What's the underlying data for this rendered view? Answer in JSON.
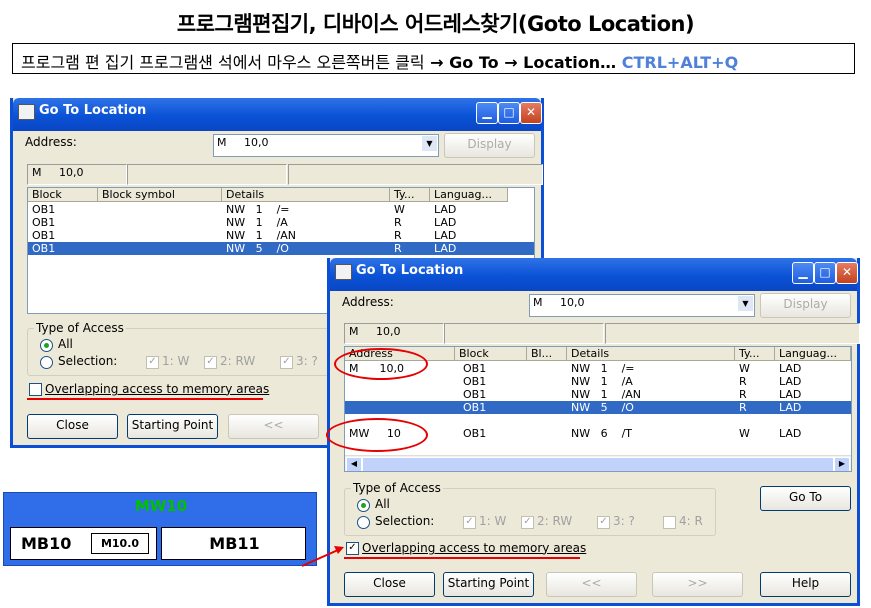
{
  "header": {
    "title": "프로그램편집기, 디바이스 어드레스찾기(Goto Location)",
    "instruction_ko": "프로그램 편 집기 프로그램섄 석에서 마우스 오른쪽버튼 클릭",
    "instruction_path": " → Go To → Location… ",
    "shortcut": "CTRL+ALT+Q"
  },
  "dialog1": {
    "title": "Go To Location",
    "address_label": "Address:",
    "address_value": "M     10,0",
    "display_button": "Display",
    "field_addr": "M     10,0",
    "columns": [
      "Block",
      "Block symbol",
      "Details",
      "Ty...",
      "Languag..."
    ],
    "rows": [
      [
        "OB1",
        "",
        "NW   1    /=",
        "W",
        "LAD"
      ],
      [
        "OB1",
        "",
        "NW   1    /A",
        "R",
        "LAD"
      ],
      [
        "OB1",
        "",
        "NW   1    /AN",
        "R",
        "LAD"
      ],
      [
        "OB1",
        "",
        "NW   5    /O",
        "R",
        "LAD"
      ]
    ],
    "type_of_access": "Type of Access",
    "all_label": "All",
    "selection_label": "Selection:",
    "sel_opts": [
      "1: W",
      "2: RW",
      "3: ?"
    ],
    "overlap_label": "Overlapping access to memory areas",
    "close_button": "Close",
    "starting_point_button": "Starting Point",
    "prev_button": "<<"
  },
  "dialog2": {
    "title": "Go To Location",
    "address_label": "Address:",
    "address_value": "M     10,0",
    "display_button": "Display",
    "field_addr": "M     10,0",
    "columns": [
      "Address",
      "Block",
      "Bl...",
      "Details",
      "Ty...",
      "Languag..."
    ],
    "rows": [
      [
        "M      10,0",
        "OB1",
        "",
        "NW   1    /=",
        "W",
        "LAD"
      ],
      [
        "",
        "OB1",
        "",
        "NW   1    /A",
        "R",
        "LAD"
      ],
      [
        "",
        "OB1",
        "",
        "NW   1    /AN",
        "R",
        "LAD"
      ],
      [
        "",
        "OB1",
        "",
        "NW   5    /O",
        "R",
        "LAD"
      ],
      [
        "MW     10",
        "OB1",
        "",
        "NW   6    /T",
        "W",
        "LAD"
      ]
    ],
    "type_of_access": "Type of Access",
    "all_label": "All",
    "selection_label": "Selection:",
    "sel_opts": [
      "1: W",
      "2: RW",
      "3: ?",
      "4: R"
    ],
    "goto_button": "Go To",
    "overlap_label": "Overlapping access to memory areas",
    "close_button": "Close",
    "starting_point_button": "Starting Point",
    "prev_button": "<<",
    "next_button": ">>",
    "help_button": "Help"
  },
  "memory_diagram": {
    "word_label": "MW10",
    "byte_left": "MB10",
    "bit_label": "M10.0",
    "byte_right": "MB11"
  },
  "colors": {
    "accent_red": "#e60000",
    "shortcut_blue": "#4f81d9",
    "word_green": "#00c000",
    "diagram_blue": "#2f6ee8"
  }
}
